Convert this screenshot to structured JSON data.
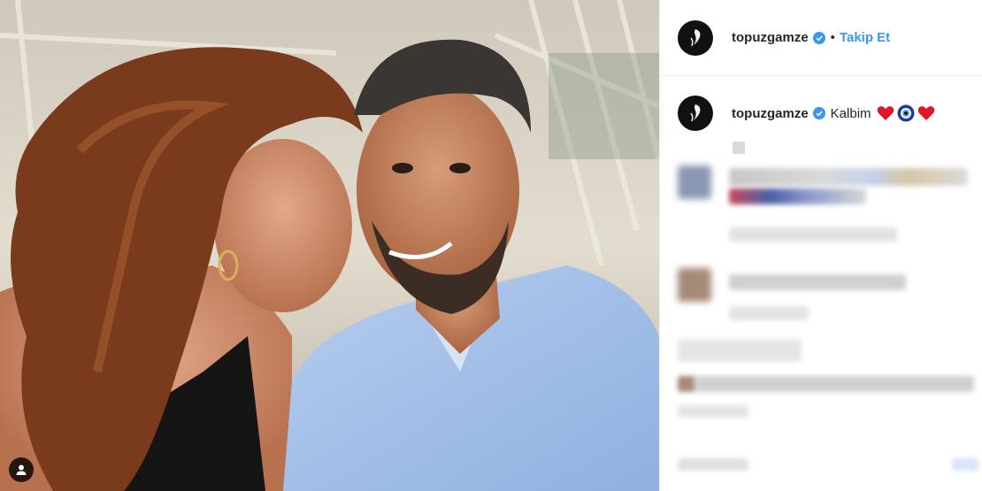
{
  "post": {
    "username": "topuzgamze",
    "separator": "•",
    "follow_label": "Takip Et",
    "caption": {
      "username": "topuzgamze",
      "text": "Kalbim",
      "emojis": [
        "red-heart",
        "nazar-amulet",
        "red-heart"
      ]
    }
  },
  "icons": {
    "verified": "verified-badge-icon",
    "tag": "user-tag-icon"
  },
  "colors": {
    "accent": "#3897f0",
    "heart": "#e0142b",
    "nazar": "#1e3c9e",
    "text": "#262626"
  }
}
